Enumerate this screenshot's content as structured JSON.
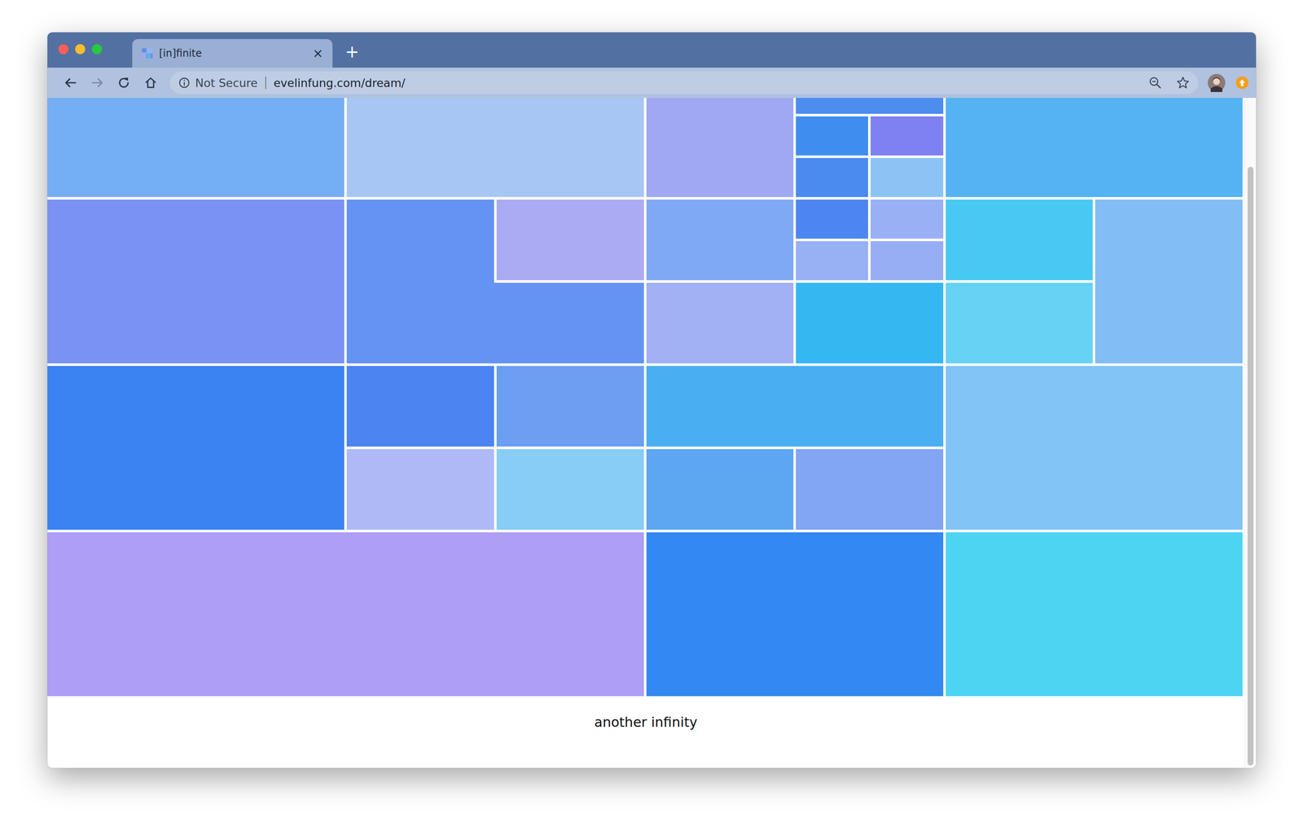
{
  "tabs": [
    {
      "label": "[in]finite",
      "selected": true,
      "close": "×"
    }
  ],
  "new_tab": "+",
  "toolbar": {
    "nav": [
      {
        "kind": "back",
        "disabled": false
      },
      {
        "kind": "forward",
        "disabled": true
      },
      {
        "kind": "reload",
        "disabled": false
      },
      {
        "kind": "home",
        "disabled": false
      }
    ],
    "security": "Not Secure",
    "url": "evelinfung.com/dream/"
  },
  "treemap": {
    "tiles": [
      {
        "color": "#74AEF4"
      },
      {
        "color": "#A8C6F4"
      },
      {
        "color": "#A0A8F4"
      },
      {
        "color": "#4C8DEE"
      },
      {
        "color": "#3F8EEF"
      },
      {
        "color": "#7F80F2"
      },
      {
        "color": "#4A8BF0"
      },
      {
        "color": "#8CC3F5"
      },
      {
        "color": "#55B3F3"
      },
      {
        "color": "#7A92F4"
      },
      {
        "color": "#6593F3"
      },
      {
        "color": "#ABABF4"
      },
      {
        "color": "#7FA9F4"
      },
      {
        "color": "#A2B0F4"
      },
      {
        "color": "#4D86F2"
      },
      {
        "color": "#9AB0F4"
      },
      {
        "color": "#98B0F4"
      },
      {
        "color": "#98AEF4"
      },
      {
        "color": "#35B7F2"
      },
      {
        "color": "#47C9F3"
      },
      {
        "color": "#67D2F4"
      },
      {
        "color": "#82BDF5"
      },
      {
        "color": "#3B82F2"
      },
      {
        "color": "#4C84F2"
      },
      {
        "color": "#AFB9F5"
      },
      {
        "color": "#6C9FF2"
      },
      {
        "color": "#87CDF4"
      },
      {
        "color": "#4AAFF2"
      },
      {
        "color": "#5CA6F2"
      },
      {
        "color": "#82A5F4"
      },
      {
        "color": "#81C4F5"
      },
      {
        "color": "#AE9EF4"
      },
      {
        "color": "#3388F2"
      },
      {
        "color": "#4DD4F3"
      }
    ]
  },
  "caption": "another infinity",
  "scroll": {
    "level": 0.9
  }
}
